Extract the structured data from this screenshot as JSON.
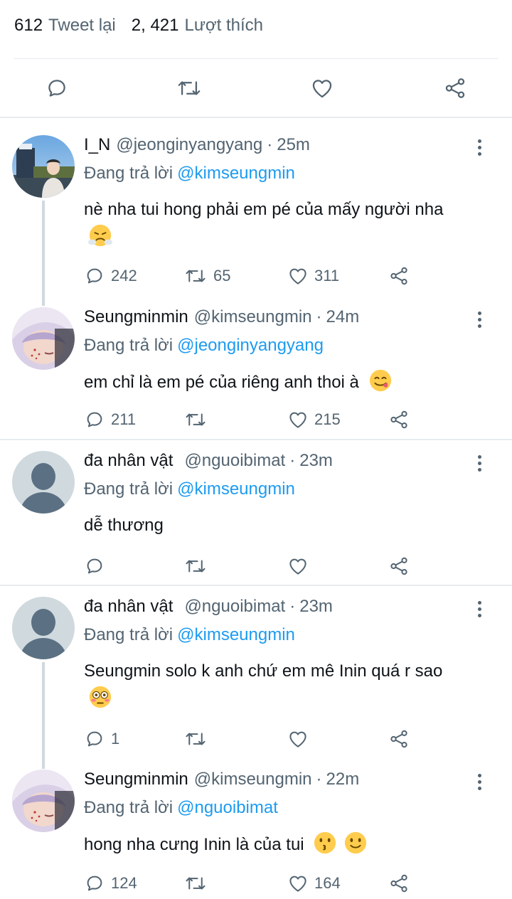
{
  "stats": {
    "retweets_count": "612",
    "retweets_label": "Tweet lại",
    "likes_count": "2, 421",
    "likes_label": "Lượt thích"
  },
  "tweets": [
    {
      "name": "I_N",
      "handle": "@jeonginyangyang",
      "time": "25m",
      "reply_prefix": "Đang trả lời",
      "reply_to": "@kimseungmin",
      "text": "nè nha tui hong phải em pé của mấy người nha",
      "emoji": "face-with-steam-icon",
      "replies": "242",
      "retweets": "65",
      "likes": "311"
    },
    {
      "name": "Seungminmin",
      "handle": "@kimseungmin",
      "time": "24m",
      "reply_prefix": "Đang trả lời",
      "reply_to": "@jeonginyangyang",
      "text": "em chỉ là em pé của riêng anh thoi à",
      "emoji": "yum-face-icon",
      "replies": "211",
      "retweets": "",
      "likes": "215"
    },
    {
      "name": "đa nhân vật",
      "handle": "@nguoibimat",
      "time": "23m",
      "reply_prefix": "Đang trả lời",
      "reply_to": "@kimseungmin",
      "text": "dễ thương",
      "replies": "",
      "retweets": "",
      "likes": ""
    },
    {
      "name": "đa nhân vật",
      "handle": "@nguoibimat",
      "time": "23m",
      "reply_prefix": "Đang trả lời",
      "reply_to": "@kimseungmin",
      "text": "Seungmin solo k anh chứ em mê Inin quá r sao",
      "emoji": "flushed-face-icon",
      "replies": "1",
      "retweets": "",
      "likes": ""
    },
    {
      "name": "Seungminmin",
      "handle": "@kimseungmin",
      "time": "22m",
      "reply_prefix": "Đang trả lời",
      "reply_to": "@nguoibimat",
      "text": "hong nha cưng Inin là của tui",
      "emoji": "kissing-face-icon",
      "emoji2": "slightly-smiling-face-icon",
      "replies": "124",
      "retweets": "",
      "likes": "164"
    }
  ],
  "colors": {
    "text": "#0f1419",
    "secondary": "#536471",
    "link": "#1d9bf0",
    "divider": "#e6ecf0",
    "thread_line": "#cfd9de",
    "default_avatar_bg": "#cfd9de",
    "default_avatar_fg": "#5b7083"
  }
}
